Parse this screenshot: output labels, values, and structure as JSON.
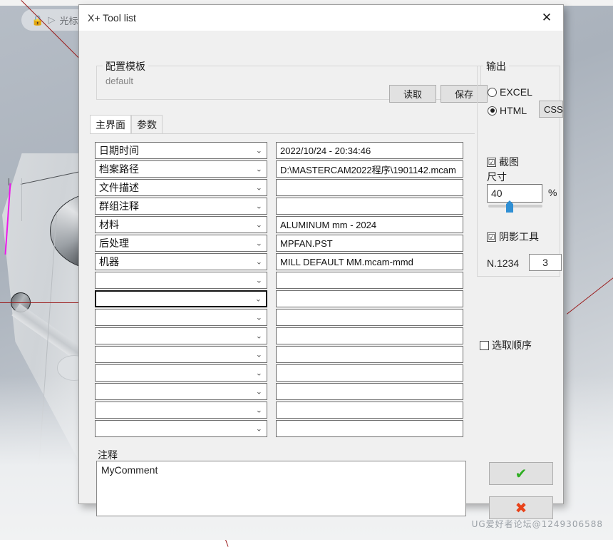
{
  "background": {
    "toolbar_pill": {
      "lock_icon": "lock-icon",
      "cursor_icon": "cursor-icon",
      "label": "光标"
    },
    "watermark": "UG爱好者论坛@1249306588"
  },
  "dialog": {
    "title": "X+ Tool list",
    "close_icon": "✕",
    "template_group": {
      "title": "配置模板",
      "value": "default",
      "read_label": "读取",
      "save_label": "保存"
    },
    "tabs": [
      {
        "label": "主界面",
        "active": true
      },
      {
        "label": "参数",
        "active": false
      }
    ],
    "rows": [
      {
        "combo": "日期时间",
        "text": "2022/10/24 - 20:34:46",
        "focused": false
      },
      {
        "combo": "档案路径",
        "text": "D:\\MASTERCAM2022程序\\1901142.mcam",
        "focused": false
      },
      {
        "combo": "文件描述",
        "text": "",
        "focused": false
      },
      {
        "combo": "群组注释",
        "text": "",
        "focused": false
      },
      {
        "combo": "材料",
        "text": "ALUMINUM mm - 2024",
        "focused": false
      },
      {
        "combo": "后处理",
        "text": "MPFAN.PST",
        "focused": false
      },
      {
        "combo": "机器",
        "text": "MILL DEFAULT MM.mcam-mmd",
        "focused": false
      },
      {
        "combo": "",
        "text": "",
        "focused": false
      },
      {
        "combo": "",
        "text": "",
        "focused": true
      },
      {
        "combo": "",
        "text": "",
        "focused": false
      },
      {
        "combo": "",
        "text": "",
        "focused": false
      },
      {
        "combo": "",
        "text": "",
        "focused": false
      },
      {
        "combo": "",
        "text": "",
        "focused": false
      },
      {
        "combo": "",
        "text": "",
        "focused": false
      },
      {
        "combo": "",
        "text": "",
        "focused": false
      },
      {
        "combo": "",
        "text": "",
        "focused": false
      }
    ],
    "comment": {
      "label": "注释",
      "value": "MyComment"
    },
    "output_group": {
      "title": "输出",
      "options": [
        {
          "label": "EXCEL",
          "selected": false
        },
        {
          "label": "HTML",
          "selected": true
        }
      ],
      "css_button": "CSS"
    },
    "capture": {
      "label": "截图",
      "checked": true,
      "check_glyph": "☑",
      "size_label": "尺寸",
      "size_value": "40",
      "percent_label": "%",
      "slider_percent": 40
    },
    "shadow_tool": {
      "label": "阴影工具",
      "checked": true,
      "check_glyph": "☑",
      "n_label": "N.1234",
      "n_value": "3"
    },
    "select_order": {
      "label": "选取顺序",
      "checked": false,
      "check_glyph": ""
    },
    "ok_button": {
      "icon": "checkmark-icon",
      "glyph": "✔"
    },
    "cancel_button": {
      "icon": "cross-icon",
      "glyph": "✖"
    }
  }
}
